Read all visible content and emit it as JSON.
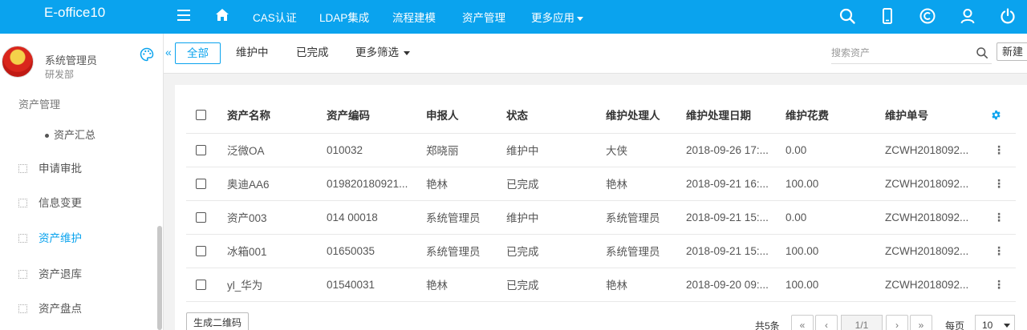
{
  "app": {
    "title": "E-office10"
  },
  "topnav": {
    "items": [
      "CAS认证",
      "LDAP集成",
      "流程建模",
      "资产管理",
      "更多应用"
    ]
  },
  "sidebar": {
    "user_name": "系统管理员",
    "user_dept": "研发部",
    "group_label": "资产管理",
    "sub_item": "资产汇总",
    "items": [
      {
        "label": "申请审批",
        "active": false
      },
      {
        "label": "信息变更",
        "active": false
      },
      {
        "label": "资产维护",
        "active": true
      },
      {
        "label": "资产退库",
        "active": false
      },
      {
        "label": "资产盘点",
        "active": false
      }
    ]
  },
  "toolbar": {
    "filters": [
      "全部",
      "维护中",
      "已完成",
      "更多筛选"
    ],
    "active_filter": "全部",
    "search_placeholder": "搜索资产",
    "new_label": "新建"
  },
  "table": {
    "columns": [
      "资产名称",
      "资产编码",
      "申报人",
      "状态",
      "维护处理人",
      "维护处理日期",
      "维护花费",
      "维护单号"
    ],
    "rows": [
      [
        "泛微OA",
        "010032",
        "郑晓丽",
        "维护中",
        "大侠",
        "2018-09-26 17:...",
        "0.00",
        "ZCWH2018092..."
      ],
      [
        "奥迪AA6",
        "019820180921...",
        "艳林",
        "已完成",
        "艳林",
        "2018-09-21 16:...",
        "100.00",
        "ZCWH2018092..."
      ],
      [
        "资产003",
        "014 00018",
        "系统管理员",
        "维护中",
        "系统管理员",
        "2018-09-21 15:...",
        "0.00",
        "ZCWH2018092..."
      ],
      [
        "冰箱001",
        "01650035",
        "系统管理员",
        "已完成",
        "系统管理员",
        "2018-09-21 15:...",
        "100.00",
        "ZCWH2018092..."
      ],
      [
        "yl_华为",
        "01540031",
        "艳林",
        "已完成",
        "艳林",
        "2018-09-20 09:...",
        "100.00",
        "ZCWH2018092..."
      ]
    ]
  },
  "footer": {
    "qr_label": "生成二维码",
    "total": "共5条",
    "page": "1/1",
    "per_page_label": "每页",
    "page_size": "10"
  },
  "colors": {
    "accent": "#0aa3ee",
    "topbar": "#0aa3ee"
  }
}
